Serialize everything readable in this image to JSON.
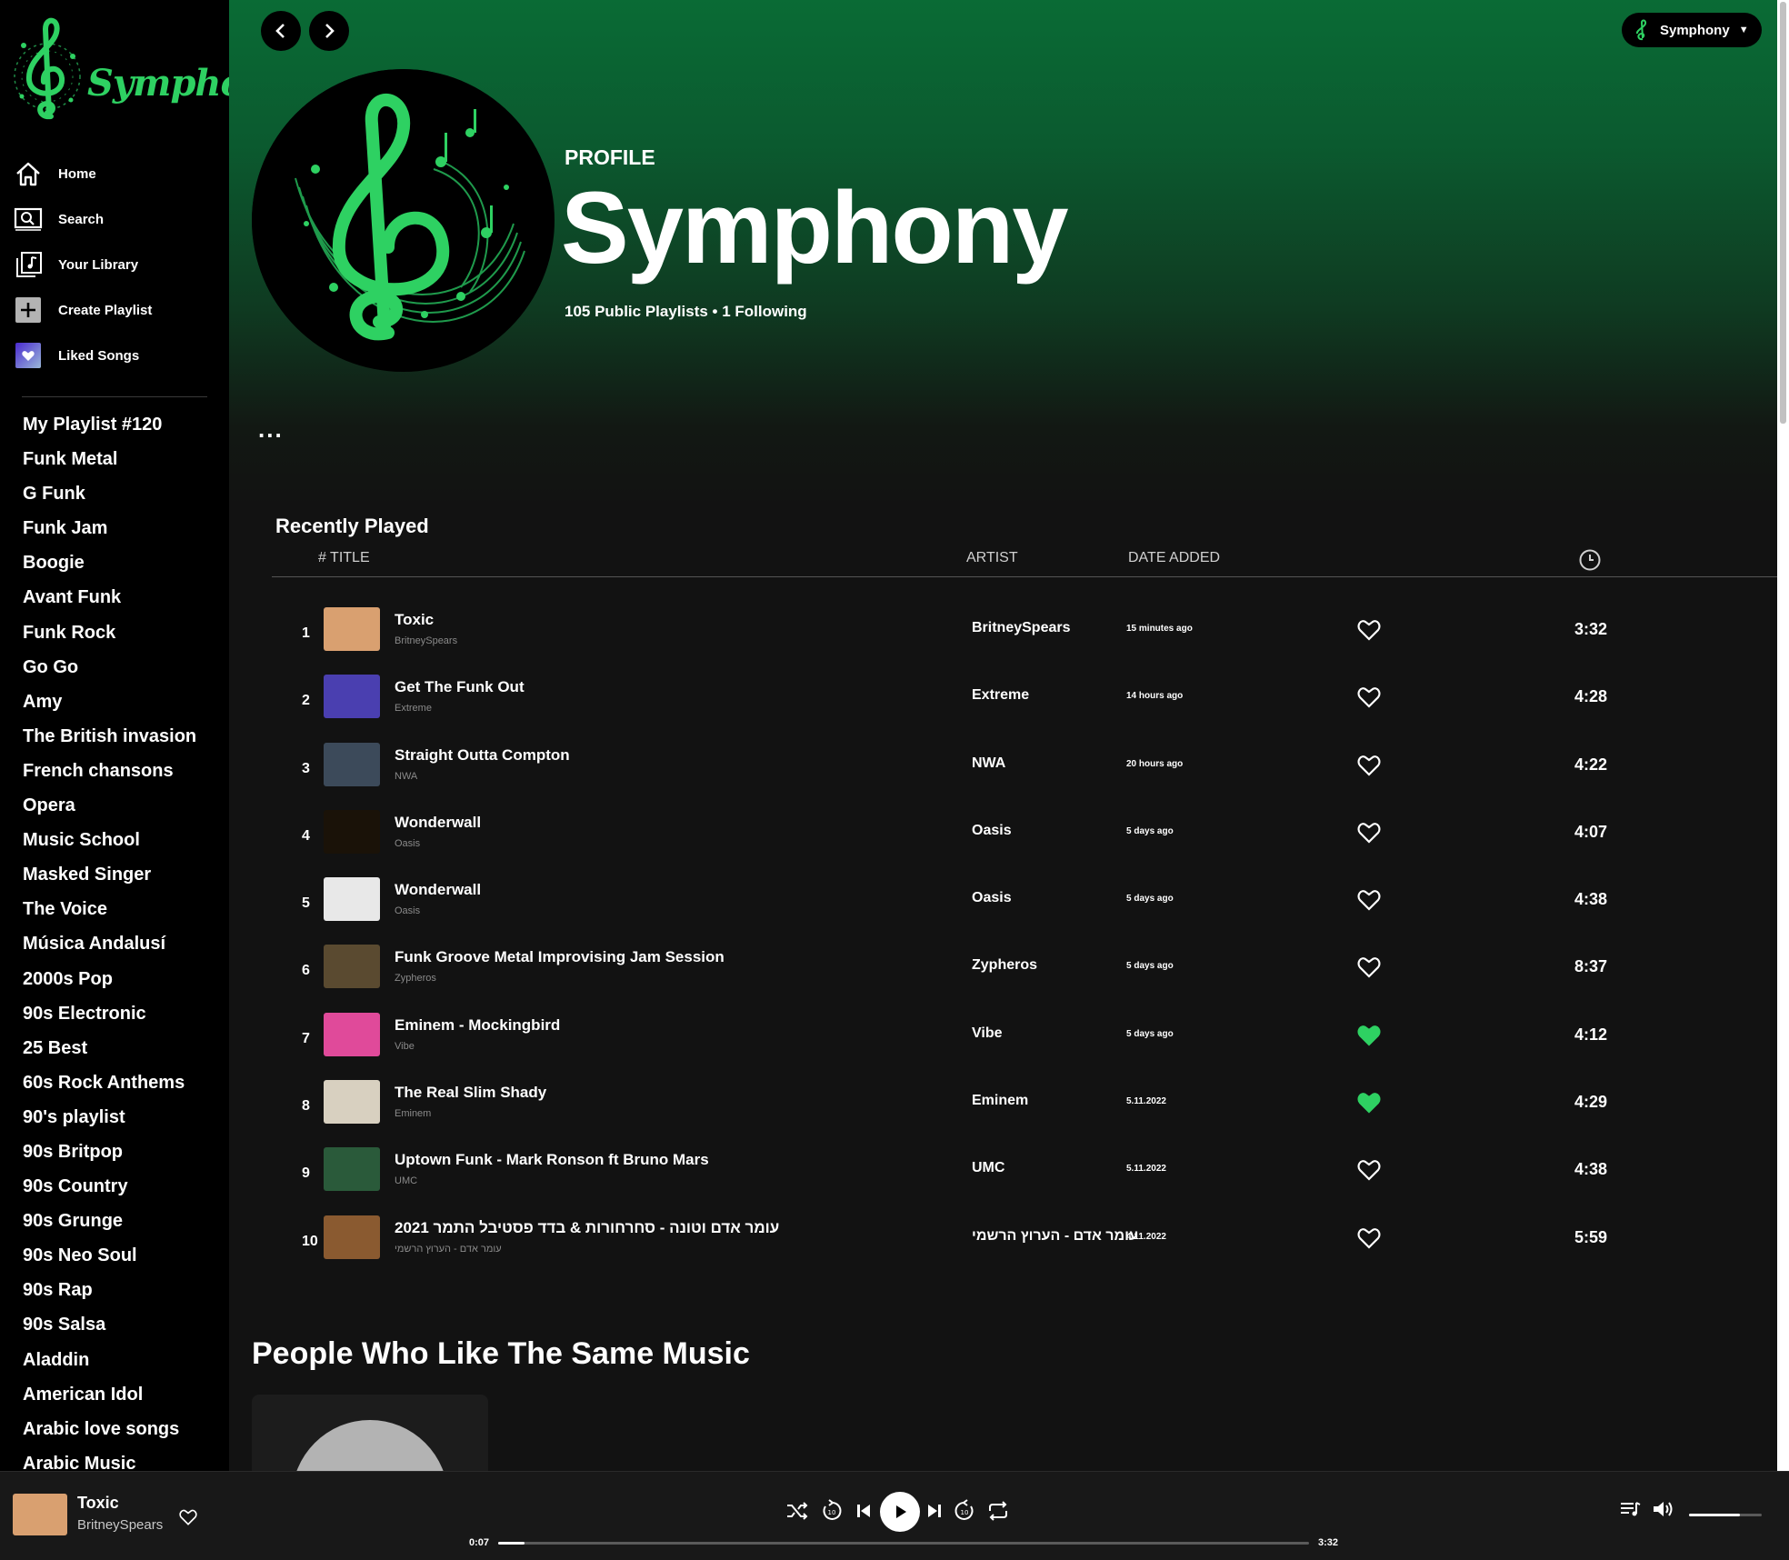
{
  "brand": {
    "name": "Symphony",
    "accent": "#2ed162"
  },
  "sidebar": {
    "nav": [
      {
        "label": "Home",
        "icon": "home-icon"
      },
      {
        "label": "Search",
        "icon": "search-icon"
      },
      {
        "label": "Your Library",
        "icon": "library-icon"
      },
      {
        "label": "Create Playlist",
        "icon": "plus-icon"
      },
      {
        "label": "Liked Songs",
        "icon": "heart-icon"
      }
    ],
    "playlists": [
      "My Playlist #120",
      "Funk Metal",
      "G Funk",
      "Funk Jam",
      "Boogie",
      "Avant Funk",
      "Funk Rock",
      "Go Go",
      "Amy",
      "The British invasion",
      "French chansons",
      "Opera",
      "Music School",
      "Masked Singer",
      "The Voice",
      "Música Andalusí",
      "2000s Pop",
      "90s Electronic",
      "25 Best",
      "60s Rock Anthems",
      "90's playlist",
      "90s Britpop",
      "90s Country",
      "90s Grunge",
      "90s Neo Soul",
      "90s Rap",
      "90s Salsa",
      "Aladdin",
      "American Idol",
      "Arabic love songs",
      "Arabic Music"
    ]
  },
  "header": {
    "user_name": "Symphony"
  },
  "profile": {
    "label": "PROFILE",
    "name": "Symphony",
    "stats": "105 Public Playlists • 1 Following",
    "more": "..."
  },
  "recent": {
    "title": "Recently Played",
    "columns": {
      "title": "# TITLE",
      "artist": "ARTIST",
      "date": "DATE ADDED",
      "duration_icon": "clock-icon"
    },
    "rows": [
      {
        "num": "1",
        "title": "Toxic",
        "sub": "BritneySpears",
        "artist": "BritneySpears",
        "date": "15 minutes ago",
        "liked": false,
        "duration": "3:32",
        "thumb": "#d9a070"
      },
      {
        "num": "2",
        "title": "Get The Funk Out",
        "sub": "Extreme",
        "artist": "Extreme",
        "date": "14 hours ago",
        "liked": false,
        "duration": "4:28",
        "thumb": "#4a3fb0"
      },
      {
        "num": "3",
        "title": "Straight Outta Compton",
        "sub": "NWA",
        "artist": "NWA",
        "date": "20 hours ago",
        "liked": false,
        "duration": "4:22",
        "thumb": "#3c4a5a"
      },
      {
        "num": "4",
        "title": "Wonderwall",
        "sub": "Oasis",
        "artist": "Oasis",
        "date": "5 days ago",
        "liked": false,
        "duration": "4:07",
        "thumb": "#1a1208"
      },
      {
        "num": "5",
        "title": "Wonderwall",
        "sub": "Oasis",
        "artist": "Oasis",
        "date": "5 days ago",
        "liked": false,
        "duration": "4:38",
        "thumb": "#e8e8e8"
      },
      {
        "num": "6",
        "title": "Funk Groove Metal Improvising Jam Session",
        "sub": "Zypheros",
        "artist": "Zypheros",
        "date": "5 days ago",
        "liked": false,
        "duration": "8:37",
        "thumb": "#5a4a30"
      },
      {
        "num": "7",
        "title": "Eminem - Mockingbird",
        "sub": "Vibe",
        "artist": "Vibe",
        "date": "5 days ago",
        "liked": true,
        "duration": "4:12",
        "thumb": "#e04a9a"
      },
      {
        "num": "8",
        "title": "The Real Slim Shady",
        "sub": "Eminem",
        "artist": "Eminem",
        "date": "5.11.2022",
        "liked": true,
        "duration": "4:29",
        "thumb": "#d8d0c0"
      },
      {
        "num": "9",
        "title": "Uptown Funk - Mark Ronson ft Bruno Mars",
        "sub": "UMC",
        "artist": "UMC",
        "date": "5.11.2022",
        "liked": false,
        "duration": "4:38",
        "thumb": "#2a5a3a"
      },
      {
        "num": "10",
        "title": "עומר אדם וטונה - סחרחורות & בדד פסטיבל התמר 2021",
        "sub": "עומר אדם - הערוץ הרשמי",
        "artist": "עומר אדם - הערוץ הרשמי",
        "date": "4.11.2022",
        "liked": false,
        "duration": "5:59",
        "thumb": "#8a5a30"
      }
    ]
  },
  "people": {
    "title": "People Who Like The Same Music"
  },
  "player": {
    "title": "Toxic",
    "artist": "BritneySpears",
    "elapsed": "0:07",
    "total": "3:32",
    "progress": 0.033,
    "volume": 0.7,
    "controls": [
      "shuffle-icon",
      "rewind-10-icon",
      "previous-icon",
      "play-icon",
      "next-icon",
      "forward-10-icon",
      "repeat-icon"
    ]
  }
}
